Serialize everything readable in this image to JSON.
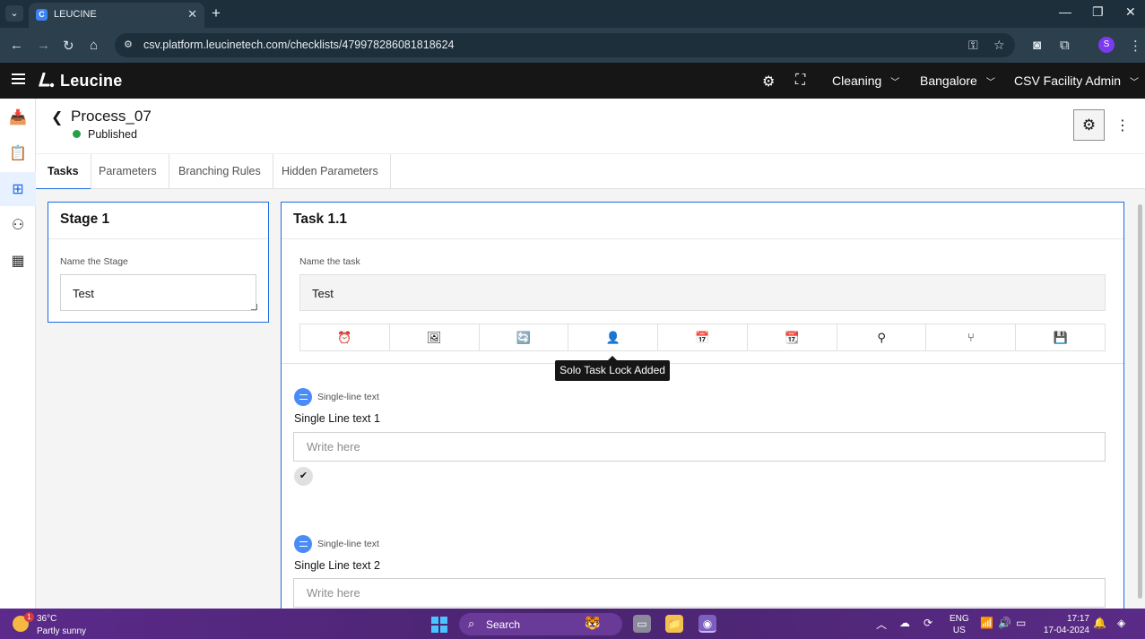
{
  "browser": {
    "tab_title": "LEUCINE",
    "tab_favicon_letter": "C",
    "url": "csv.platform.leucinetech.com/checklists/479978286081818624",
    "profile_initial": "S"
  },
  "app": {
    "brand": "Leucine",
    "selectors": [
      "Cleaning",
      "Bangalore",
      "CSV Facility Admin"
    ]
  },
  "page": {
    "title": "Process_07",
    "status": "Published",
    "status_color": "#24a148"
  },
  "tabs": [
    {
      "label": "Tasks",
      "active": true
    },
    {
      "label": "Parameters",
      "active": false
    },
    {
      "label": "Branching Rules",
      "active": false
    },
    {
      "label": "Hidden Parameters",
      "active": false
    }
  ],
  "stage": {
    "title": "Stage 1",
    "field_label": "Name the Stage",
    "value": "Test"
  },
  "task": {
    "title": "Task 1.1",
    "field_label": "Name the task",
    "value": "Test",
    "toolbar_icons": [
      "alarm-clock-icon",
      "image-icon",
      "refresh-icon",
      "user-lock-icon",
      "calendar-icon",
      "calendar-clock-icon",
      "hierarchy-icon",
      "branch-icon",
      "save-icon"
    ],
    "tooltip": "Solo Task Lock Added",
    "params": [
      {
        "type": "Single-line text",
        "label": "Single Line text 1",
        "placeholder": "Write here"
      },
      {
        "type": "Single-line text",
        "label": "Single Line text 2",
        "placeholder": "Write here"
      }
    ]
  },
  "taskbar": {
    "temperature": "36°C",
    "condition": "Partly sunny",
    "weather_badge": "1",
    "search": "Search",
    "lang_top": "ENG",
    "lang_bottom": "US",
    "time": "17:17",
    "date": "17-04-2024"
  },
  "colors": {
    "accent": "#1d6ce0",
    "header_bg": "#161616",
    "param_badge": "#4a8cf7"
  }
}
